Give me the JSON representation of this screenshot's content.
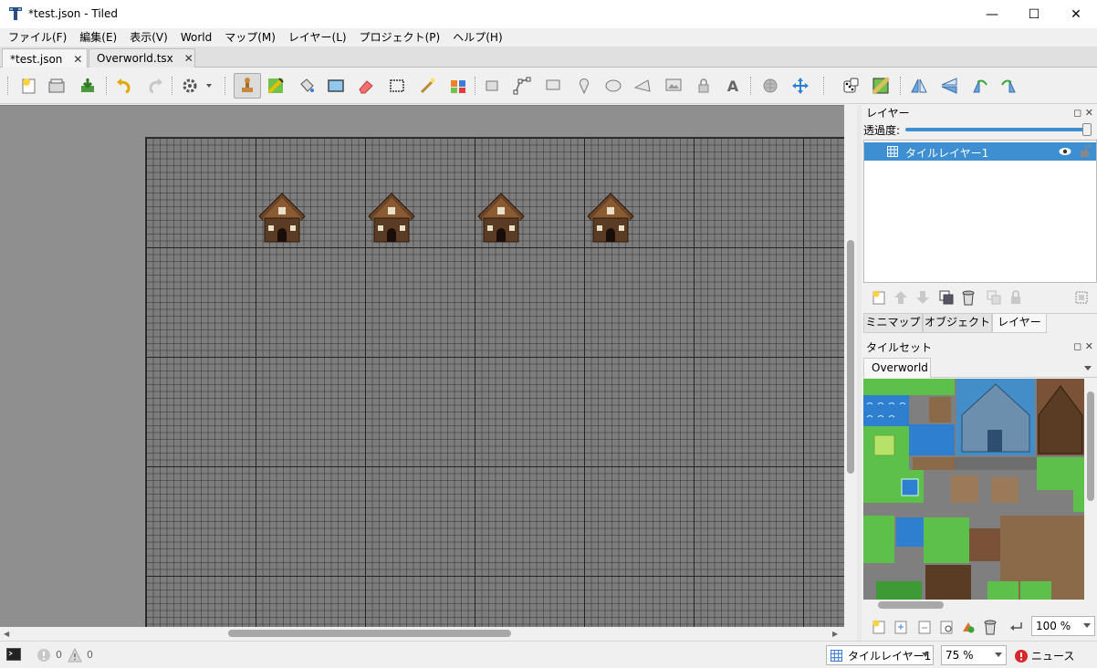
{
  "window": {
    "title": "*test.json - Tiled",
    "minimize_glyph": "—",
    "maximize_glyph": "☐",
    "close_glyph": "✕"
  },
  "menu": [
    "ファイル(F)",
    "編集(E)",
    "表示(V)",
    "World",
    "マップ(M)",
    "レイヤー(L)",
    "プロジェクト(P)",
    "ヘルプ(H)"
  ],
  "tabs": [
    {
      "label": "*test.json",
      "close": "✕"
    },
    {
      "label": "Overworld.tsx",
      "close": "✕"
    }
  ],
  "toolbar": {
    "icons": [
      "new-map-icon",
      "open-icon",
      "save-icon",
      "undo-icon",
      "redo-icon",
      "commands-icon",
      "stamp-brush-icon",
      "terrain-brush-icon",
      "bucket-fill-icon",
      "shape-fill-icon",
      "eraser-icon",
      "rect-select-icon",
      "magic-wand-icon",
      "select-same-tile-icon",
      "select-objects-icon",
      "edit-polygons-icon",
      "insert-rectangle-icon",
      "insert-point-icon",
      "insert-ellipse-icon",
      "insert-polygon-icon",
      "insert-tile-icon",
      "insert-template-icon",
      "insert-text-icon",
      "world-tool-icon",
      "move-icon",
      "random-mode-icon",
      "wang-fill-icon",
      "flip-horizontal-icon",
      "flip-vertical-icon",
      "rotate-left-icon",
      "rotate-right-icon"
    ]
  },
  "layers_panel": {
    "title": "レイヤー",
    "opacity_label": "透過度:",
    "opacity_value": 100,
    "layers": [
      {
        "name": "タイルレイヤー1",
        "visible": true,
        "selected": true
      }
    ],
    "tabs": [
      "ミニマップ",
      "オブジェクト",
      "レイヤー"
    ],
    "active_tab": "レイヤー"
  },
  "tileset_panel": {
    "title": "タイルセット",
    "tab": "Overworld",
    "zoom": "100 %"
  },
  "statusbar": {
    "errors": "0",
    "warnings": "0",
    "layer_combo": "タイルレイヤー1",
    "zoom": "75 %",
    "news": "ニュース"
  },
  "colors": {
    "selection": "#3d8fd1",
    "canvas_bg": "#8f8f8f",
    "map_bg": "#7d7d7d"
  }
}
